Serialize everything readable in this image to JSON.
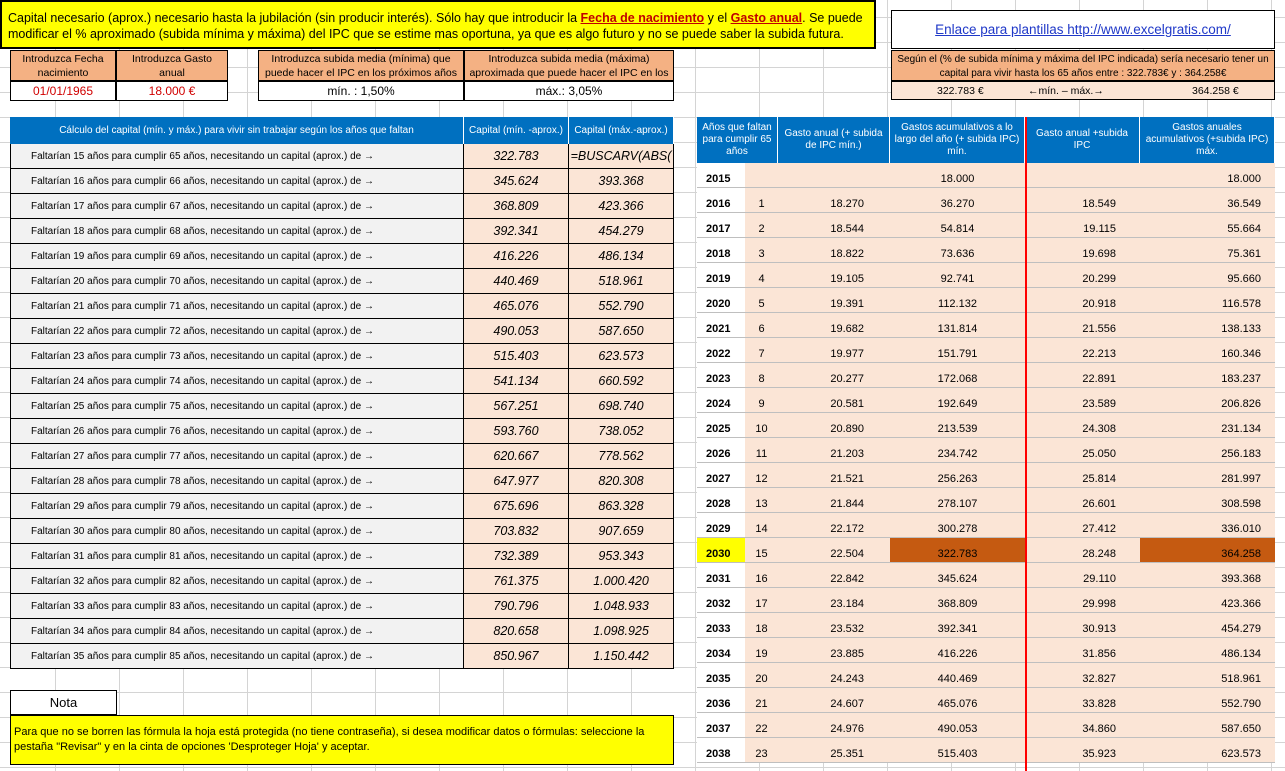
{
  "header": {
    "note_pre": "Capital necesario (aprox.) necesario hasta la jubilación (sin producir interés).  Sólo hay que introducir la ",
    "note_hl1": "Fecha de nacimiento",
    "note_mid": " y el ",
    "note_hl2": "Gasto anual",
    "note_post": ".  Se puede modificar el  % aproximado (subida mínima y máxima) del IPC que se estime  mas oportuna, ya que es algo futuro y no se puede saber la subida futura.",
    "link": "Enlace para plantillas http://www.excelgratis.com/"
  },
  "inputs": {
    "birth_label": "Introduzca Fecha nacimiento",
    "birth_value": "01/01/1965",
    "expense_label": "Introduzca Gasto anual",
    "expense_value": "18.000 €",
    "min_label": "Introduzca subida media (mínima) que puede hacer el IPC en los próximos años",
    "min_value": "mín. : 1,50%",
    "max_label": "Introduzca subida media (máxima) aproximada que puede hacer el IPC en los",
    "max_value": "máx.: 3,05%"
  },
  "result": {
    "text": "Según el  (% de subida mínima y máxima del IPC indicada) sería necesario tener un capital para  vivir hasta los 65 años  entre : 322.783€ y : 364.258€",
    "min": "322.783 €",
    "range": "←mín. – máx.→",
    "max": "364.258 €"
  },
  "left_table": {
    "h_desc": "Cálculo del capital (mín. y máx.) para vivir sin trabajar según los años que faltan",
    "h_min": "Capital (mín. -aprox.)",
    "h_max": "Capital (máx.-aprox.)",
    "rows": [
      {
        "d": "Faltarían 15 años   para cumplir  65 años,  necesitando un capital (aprox.) de →",
        "min": "322.783",
        "max": "=BUSCARV(ABS("
      },
      {
        "d": "Faltarían 16 años   para cumplir  66 años,  necesitando un capital (aprox.) de →",
        "min": "345.624",
        "max": "393.368"
      },
      {
        "d": "Faltarían 17 años   para cumplir  67 años,  necesitando un capital (aprox.) de →",
        "min": "368.809",
        "max": "423.366"
      },
      {
        "d": "Faltarían 18 años   para cumplir  68 años,  necesitando un capital (aprox.) de →",
        "min": "392.341",
        "max": "454.279"
      },
      {
        "d": "Faltarían 19 años   para cumplir  69 años,  necesitando un capital (aprox.) de →",
        "min": "416.226",
        "max": "486.134"
      },
      {
        "d": "Faltarían 20 años   para cumplir  70 años,  necesitando un capital (aprox.) de →",
        "min": "440.469",
        "max": "518.961"
      },
      {
        "d": "Faltarían 21 años   para cumplir  71 años,  necesitando un capital (aprox.) de →",
        "min": "465.076",
        "max": "552.790"
      },
      {
        "d": "Faltarían 22 años   para cumplir  72 años,  necesitando un capital (aprox.) de →",
        "min": "490.053",
        "max": "587.650"
      },
      {
        "d": "Faltarían 23 años   para cumplir  73 años,  necesitando un capital (aprox.) de →",
        "min": "515.403",
        "max": "623.573"
      },
      {
        "d": "Faltarían 24 años   para cumplir  74 años,  necesitando un capital (aprox.) de →",
        "min": "541.134",
        "max": "660.592"
      },
      {
        "d": "Faltarían 25 años   para cumplir  75 años,  necesitando un capital (aprox.) de →",
        "min": "567.251",
        "max": "698.740"
      },
      {
        "d": "Faltarían 26 años   para cumplir  76 años,  necesitando un capital (aprox.) de →",
        "min": "593.760",
        "max": "738.052"
      },
      {
        "d": "Faltarían 27 años   para cumplir  77 años,  necesitando un capital (aprox.) de →",
        "min": "620.667",
        "max": "778.562"
      },
      {
        "d": "Faltarían 28 años   para cumplir  78 años,  necesitando un capital (aprox.) de →",
        "min": "647.977",
        "max": "820.308"
      },
      {
        "d": "Faltarían 29 años   para cumplir  79 años,  necesitando un capital (aprox.) de →",
        "min": "675.696",
        "max": "863.328"
      },
      {
        "d": "Faltarían 30 años   para cumplir  80 años,  necesitando un capital (aprox.) de →",
        "min": "703.832",
        "max": "907.659"
      },
      {
        "d": "Faltarían 31 años   para cumplir  81 años,  necesitando un capital (aprox.) de →",
        "min": "732.389",
        "max": "953.343"
      },
      {
        "d": "Faltarían 32 años   para cumplir  82 años,  necesitando un capital (aprox.) de →",
        "min": "761.375",
        "max": "1.000.420"
      },
      {
        "d": "Faltarían 33 años   para cumplir  83 años,  necesitando un capital (aprox.) de →",
        "min": "790.796",
        "max": "1.048.933"
      },
      {
        "d": "Faltarían 34 años   para cumplir  84 años,  necesitando un capital (aprox.) de →",
        "min": "820.658",
        "max": "1.098.925"
      },
      {
        "d": "Faltarían 35 años   para cumplir  85 años,  necesitando un capital (aprox.) de →",
        "min": "850.967",
        "max": "1.150.442"
      }
    ]
  },
  "right_table": {
    "h_years": "Años que faltan para cumplir 65 años",
    "h_gmin": "Gasto anual  (+ subida de IPC mín.)",
    "h_amin": "Gastos acumulativos a lo largo del año (+ subida IPC) mín.",
    "h_gmax": "Gasto anual +subida IPC",
    "h_amax": "Gastos anuales acumulativos (+subida IPC) máx.",
    "highlight_year": "2030",
    "rows": [
      [
        "2015",
        "",
        "",
        "18.000",
        "",
        "18.000"
      ],
      [
        "2016",
        "1",
        "18.270",
        "36.270",
        "18.549",
        "36.549"
      ],
      [
        "2017",
        "2",
        "18.544",
        "54.814",
        "19.115",
        "55.664"
      ],
      [
        "2018",
        "3",
        "18.822",
        "73.636",
        "19.698",
        "75.361"
      ],
      [
        "2019",
        "4",
        "19.105",
        "92.741",
        "20.299",
        "95.660"
      ],
      [
        "2020",
        "5",
        "19.391",
        "112.132",
        "20.918",
        "116.578"
      ],
      [
        "2021",
        "6",
        "19.682",
        "131.814",
        "21.556",
        "138.133"
      ],
      [
        "2022",
        "7",
        "19.977",
        "151.791",
        "22.213",
        "160.346"
      ],
      [
        "2023",
        "8",
        "20.277",
        "172.068",
        "22.891",
        "183.237"
      ],
      [
        "2024",
        "9",
        "20.581",
        "192.649",
        "23.589",
        "206.826"
      ],
      [
        "2025",
        "10",
        "20.890",
        "213.539",
        "24.308",
        "231.134"
      ],
      [
        "2026",
        "11",
        "21.203",
        "234.742",
        "25.050",
        "256.183"
      ],
      [
        "2027",
        "12",
        "21.521",
        "256.263",
        "25.814",
        "281.997"
      ],
      [
        "2028",
        "13",
        "21.844",
        "278.107",
        "26.601",
        "308.598"
      ],
      [
        "2029",
        "14",
        "22.172",
        "300.278",
        "27.412",
        "336.010"
      ],
      [
        "2030",
        "15",
        "22.504",
        "322.783",
        "28.248",
        "364.258"
      ],
      [
        "2031",
        "16",
        "22.842",
        "345.624",
        "29.110",
        "393.368"
      ],
      [
        "2032",
        "17",
        "23.184",
        "368.809",
        "29.998",
        "423.366"
      ],
      [
        "2033",
        "18",
        "23.532",
        "392.341",
        "30.913",
        "454.279"
      ],
      [
        "2034",
        "19",
        "23.885",
        "416.226",
        "31.856",
        "486.134"
      ],
      [
        "2035",
        "20",
        "24.243",
        "440.469",
        "32.827",
        "518.961"
      ],
      [
        "2036",
        "21",
        "24.607",
        "465.076",
        "33.828",
        "552.790"
      ],
      [
        "2037",
        "22",
        "24.976",
        "490.053",
        "34.860",
        "587.650"
      ],
      [
        "2038",
        "23",
        "25.351",
        "515.403",
        "35.923",
        "623.573"
      ]
    ]
  },
  "nota": {
    "label": "Nota",
    "text": "Para que no se borren las fórmula la hoja está protegida (no tiene contraseña), si desea modificar datos o fórmulas: seleccione la pestaña \"Revisar\" y en la cinta de opciones  'Desproteger Hoja'  y aceptar."
  },
  "colors": {
    "accent": "#0070c0",
    "input_orange": "#f4b183",
    "cell_peach": "#fbe5d6",
    "highlight": "#c55a11",
    "note_yellow": "#ffff00",
    "divider_red": "#ff0000"
  }
}
